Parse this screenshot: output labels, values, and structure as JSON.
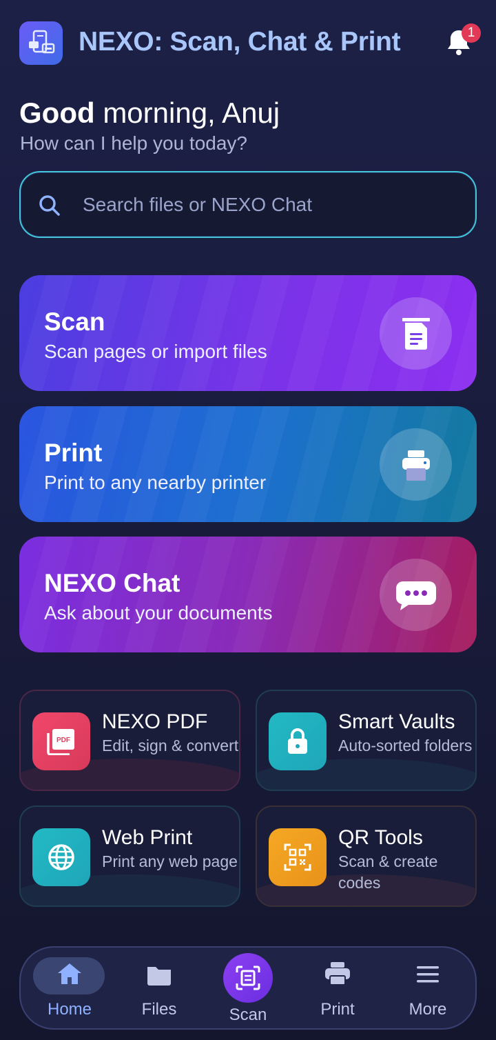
{
  "header": {
    "app_title": "NEXO: Scan, Chat & Print",
    "notification_count": "1"
  },
  "greeting": {
    "hello": "Good",
    "rest": "morning, Anuj",
    "subtitle": "How can I help you today?"
  },
  "search": {
    "placeholder": "Search files or NEXO Chat",
    "value": ""
  },
  "actions": [
    {
      "title": "Scan",
      "subtitle": "Scan pages or import files"
    },
    {
      "title": "Print",
      "subtitle": "Print to any nearby printer"
    },
    {
      "title": "NEXO Chat",
      "subtitle": "Ask about your documents"
    }
  ],
  "tiles": [
    {
      "title": "NEXO PDF",
      "subtitle": "Edit, sign & convert"
    },
    {
      "title": "Smart Vaults",
      "subtitle": "Auto-sorted folders"
    },
    {
      "title": "Web Print",
      "subtitle": "Print any web page"
    },
    {
      "title": "QR Tools",
      "subtitle": "Scan & create codes"
    }
  ],
  "nav": [
    {
      "label": "Home",
      "icon": "home-icon",
      "active": true
    },
    {
      "label": "Files",
      "icon": "folder-icon"
    },
    {
      "label": "Scan",
      "icon": "scan-icon"
    },
    {
      "label": "Print",
      "icon": "printer-icon"
    },
    {
      "label": "More",
      "icon": "menu-icon"
    }
  ],
  "colors": {
    "accent": "#8c3ff2",
    "search_border": "#43c6d8",
    "badge": "#e23a56",
    "title_text": "#a9c6fb"
  }
}
